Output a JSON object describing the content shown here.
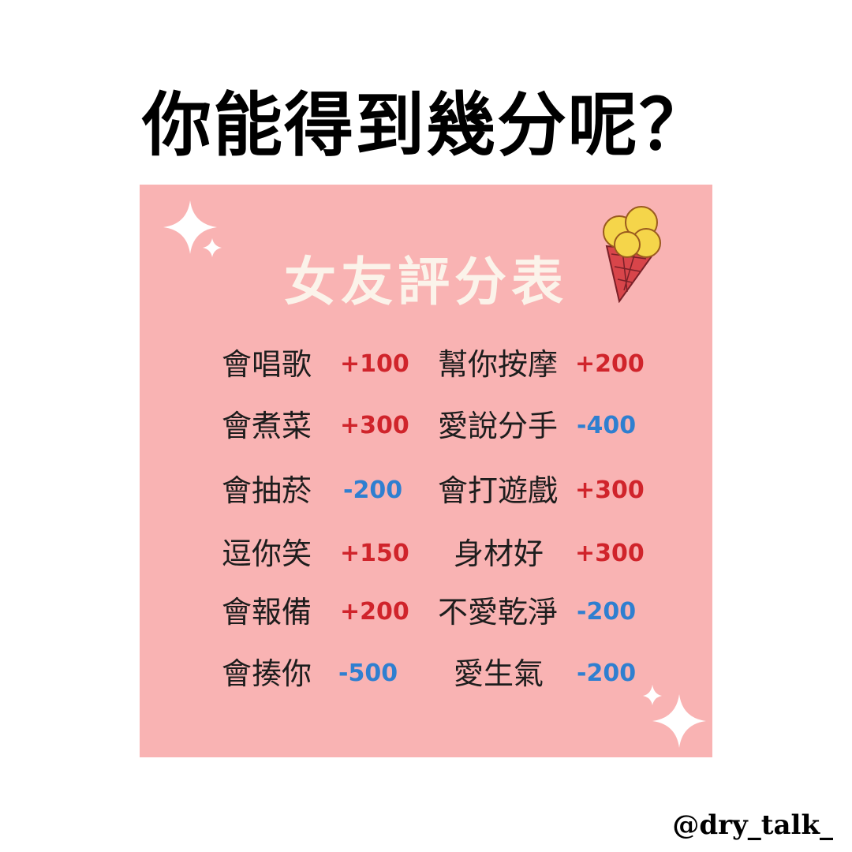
{
  "headline": "你能得到幾分呢？",
  "card": {
    "title": "女友評分表",
    "left_items": [
      {
        "label": "會唱歌",
        "score": "+100"
      },
      {
        "label": "會煮菜",
        "score": "+300"
      },
      {
        "label": "會抽菸",
        "score": "-200"
      },
      {
        "label": "逗你笑",
        "score": "+150"
      },
      {
        "label": "會報備",
        "score": "+200"
      },
      {
        "label": "會揍你",
        "score": "-500"
      }
    ],
    "right_items": [
      {
        "label": "幫你按摩",
        "score": "+200"
      },
      {
        "label": "愛說分手",
        "score": "-400"
      },
      {
        "label": "會打遊戲",
        "score": "+300"
      },
      {
        "label": "身材好",
        "score": "+300"
      },
      {
        "label": "不愛乾淨",
        "score": "-200"
      },
      {
        "label": "愛生氣",
        "score": "-200"
      }
    ],
    "icons": [
      "sparkle-icon",
      "ice-cream-icon"
    ]
  },
  "colors": {
    "card_bg": "#f9b3b3",
    "title": "#fbf3ea",
    "positive": "#d0242b",
    "negative": "#2f7fd0"
  },
  "handle": "@dry_talk_"
}
